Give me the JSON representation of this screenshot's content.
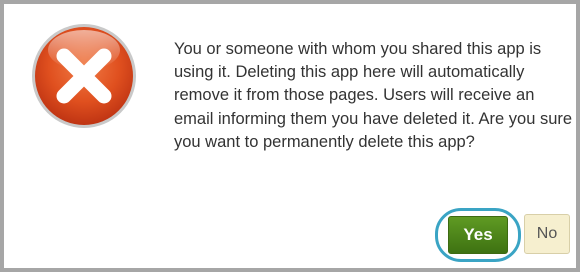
{
  "dialog": {
    "icon": "error-x-icon",
    "message": "You or someone with whom you shared this app is using it. Deleting this app here will automatically remove it from those pages. Users will receive an email informing them you have deleted it. Are you sure you want to permanently delete this app?",
    "yes_label": "Yes",
    "no_label": "No"
  },
  "colors": {
    "icon_red": "#d9411c",
    "yes_green": "#4f861a",
    "focus_ring": "#3aa4c4",
    "no_bg": "#f6efcf",
    "border_gray": "#a6a6a6"
  }
}
